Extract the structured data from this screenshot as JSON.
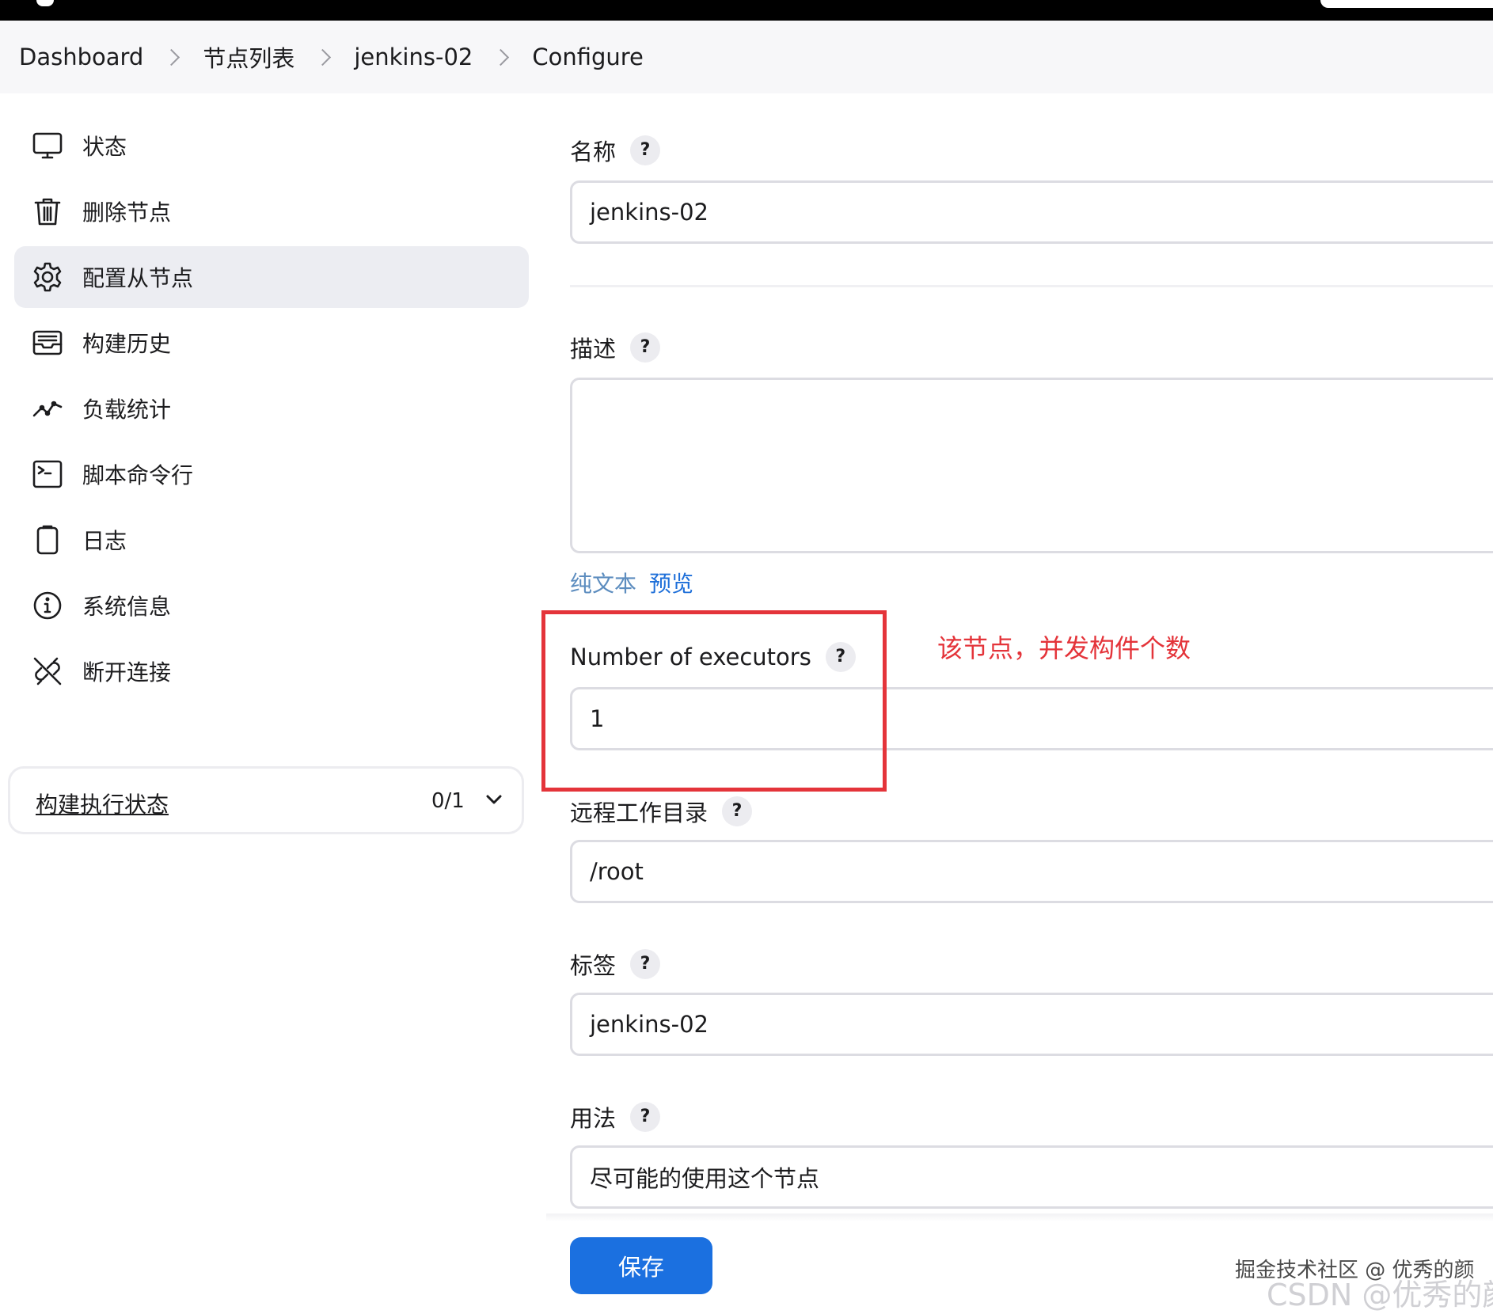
{
  "breadcrumb": [
    "Dashboard",
    "节点列表",
    "jenkins-02",
    "Configure"
  ],
  "sidebar": {
    "items": [
      {
        "label": "状态",
        "icon": "monitor-icon"
      },
      {
        "label": "删除节点",
        "icon": "trash-icon"
      },
      {
        "label": "配置从节点",
        "icon": "gear-icon",
        "active": true
      },
      {
        "label": "构建历史",
        "icon": "inbox-icon"
      },
      {
        "label": "负载统计",
        "icon": "trend-line-icon"
      },
      {
        "label": "脚本命令行",
        "icon": "terminal-icon"
      },
      {
        "label": "日志",
        "icon": "clipboard-icon"
      },
      {
        "label": "系统信息",
        "icon": "info-icon"
      },
      {
        "label": "断开连接",
        "icon": "disconnect-icon"
      }
    ]
  },
  "executor_status": {
    "label": "构建执行状态",
    "count": "0/1"
  },
  "form": {
    "name": {
      "label": "名称",
      "value": "jenkins-02"
    },
    "description": {
      "label": "描述",
      "value": ""
    },
    "format": {
      "plain": "纯文本",
      "preview": "预览"
    },
    "executors": {
      "label": "Number of executors",
      "value": "1"
    },
    "remote_dir": {
      "label": "远程工作目录",
      "value": "/root"
    },
    "labels": {
      "label": "标签",
      "value": "jenkins-02"
    },
    "usage": {
      "label": "用法",
      "value": "尽可能的使用这个节点"
    },
    "help": "?",
    "save_label": "保存"
  },
  "annotation": {
    "text": "该节点，并发构件个数",
    "color": "#e4343a"
  },
  "watermark": {
    "line1": "掘金技术社区 @ 优秀的颜",
    "line2": "CSDN @优秀的颜"
  },
  "colors": {
    "accent": "#1b70e0",
    "link": "#1e6fd9",
    "annotation": "#e4343a"
  }
}
